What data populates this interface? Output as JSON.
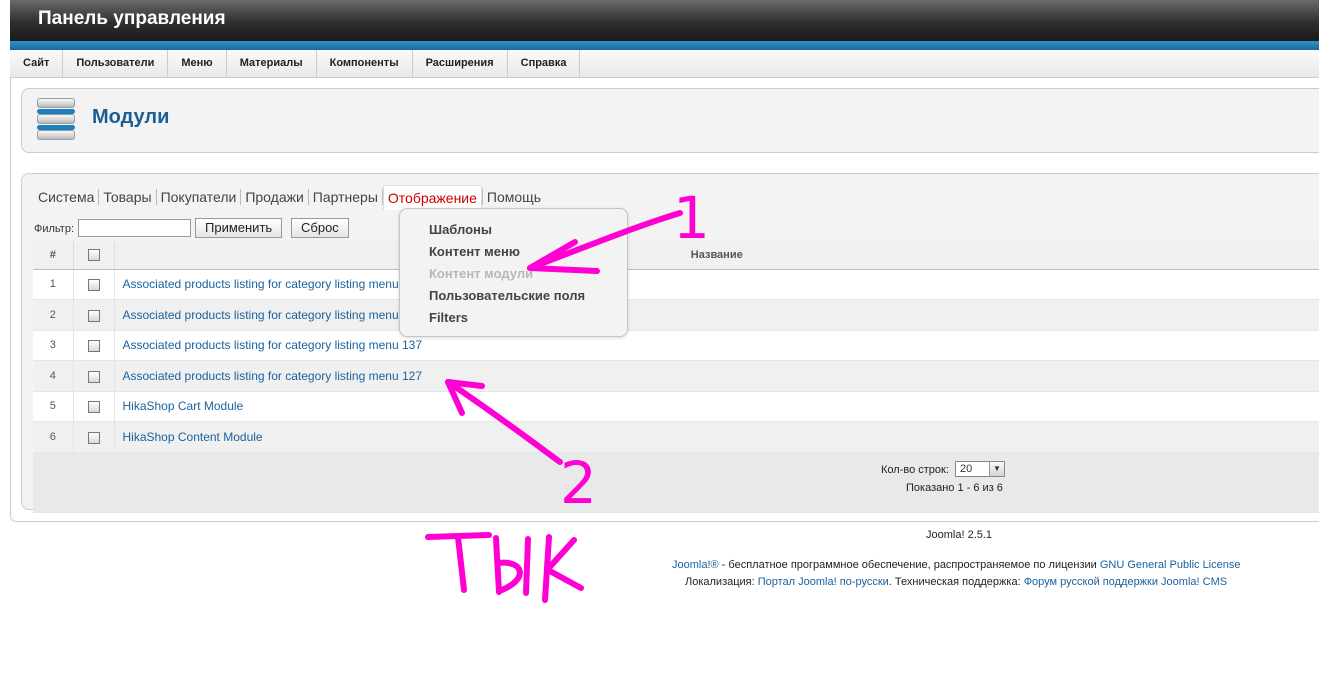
{
  "header": {
    "title": "Панель управления"
  },
  "topnav": [
    "Сайт",
    "Пользователи",
    "Меню",
    "Материалы",
    "Компоненты",
    "Расширения",
    "Справка"
  ],
  "page": {
    "title": "Модули"
  },
  "hikamenu": {
    "items": [
      "Система",
      "Товары",
      "Покупатели",
      "Продажи",
      "Партнеры",
      "Отображение",
      "Помощь"
    ],
    "active": "Отображение"
  },
  "filter": {
    "label": "Фильтр:",
    "value": "",
    "apply_label": "Применить",
    "reset_label": "Сброс"
  },
  "table": {
    "headers": {
      "num": "#",
      "name": "Название"
    },
    "rows": [
      {
        "num": "1",
        "name": "Associated products listing for category listing menu 1"
      },
      {
        "num": "2",
        "name": "Associated products listing for category listing menu 1"
      },
      {
        "num": "3",
        "name": "Associated products listing for category listing menu 137"
      },
      {
        "num": "4",
        "name": "Associated products listing for category listing menu 127"
      },
      {
        "num": "5",
        "name": "HikaShop Cart Module"
      },
      {
        "num": "6",
        "name": "HikaShop Content Module"
      }
    ]
  },
  "pagination": {
    "rows_label": "Кол-во строк:",
    "rows_value": "20",
    "info": "Показано 1 - 6 из 6"
  },
  "dropdown": {
    "items": [
      "Шаблоны",
      "Контент меню",
      "Контент модули",
      "Пользовательские поля",
      "Filters"
    ],
    "hovered": "Контент модули"
  },
  "footer": {
    "version": "Joomla! 2.5.1",
    "line1": {
      "link1": "Joomla!®",
      "text": " - бесплатное программное обеспечение, распространяемое по лицензии ",
      "link2": "GNU General Public License"
    },
    "line2": {
      "text1": "Локализация: ",
      "link1": "Портал Joomla! по-русски",
      "text2": ". Техническая поддержка: ",
      "link2": "Форум русской поддержки Joomla! CMS"
    }
  },
  "annotations": {
    "label1": "1",
    "label2": "2",
    "tyk": "ТЫК",
    "color": "#ff00d4"
  },
  "colors": {
    "accent_blue": "#1b5e91",
    "active_red": "#cc0000",
    "header_bar": "#2f94c8"
  }
}
